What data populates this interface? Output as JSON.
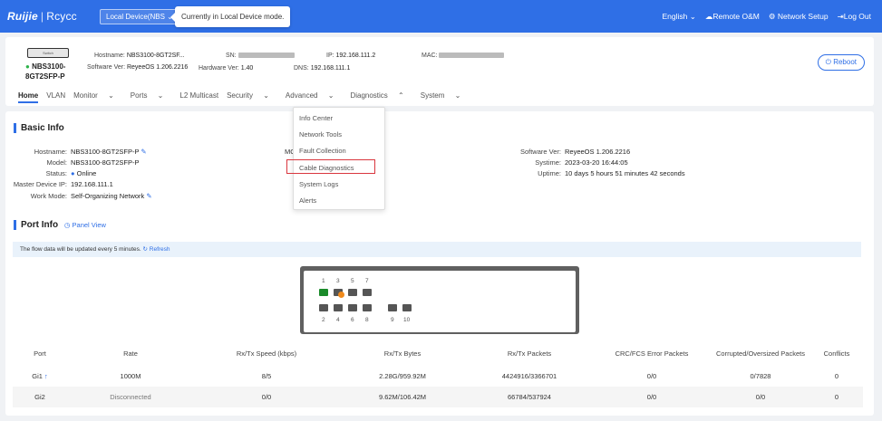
{
  "topbar": {
    "logo_brand": "Ruijie",
    "logo_sep": "|",
    "logo_sub": "Rcycc",
    "device_mode": "Local Device(NBS",
    "tip": "Currently in Local Device mode.",
    "language": "English",
    "remote": "Remote O&M",
    "network_setup": "Network Setup",
    "logout": "Log Out"
  },
  "device": {
    "icon_label": "Switch",
    "name_line1": "NBS3100-",
    "name_line2": "8GT2SFP-P",
    "hostname_label": "Hostname:",
    "hostname_value": "NBS3100-8GT2SF...",
    "sn_label": "SN:",
    "ip_label": "IP:",
    "ip_value": "192.168.111.2",
    "mac_label": "MAC:",
    "sw_label": "Software Ver:",
    "sw_value": "ReyeeOS 1.206.2216",
    "hw_label": "Hardware Ver:",
    "hw_value": "1.40",
    "dns_label": "DNS:",
    "dns_value": "192.168.111.1",
    "reboot": "Reboot"
  },
  "nav": [
    "Home",
    "VLAN",
    "Monitor",
    "Ports",
    "L2 Multicast",
    "Security",
    "Advanced",
    "Diagnostics",
    "System"
  ],
  "basic_info": {
    "title": "Basic Info",
    "hostname_label": "Hostname:",
    "hostname_value": "NBS3100-8GT2SFP-P",
    "model_label": "Model:",
    "model_value": "NBS3100-8GT2SFP-P",
    "status_label": "Status:",
    "status_value": "Online",
    "master_label": "Master Device IP:",
    "master_value": "192.168.111.1",
    "workmode_label": "Work Mode:",
    "workmode_value": "Self-Organizing Network",
    "mac_label": "MC",
    "sw_label": "Software Ver:",
    "sw_value": "ReyeeOS 1.206.2216",
    "systime_label": "Systime:",
    "systime_value": "2023-03-20 16:44:05",
    "uptime_label": "Uptime:",
    "uptime_value": "10 days 5 hours 51 minutes 42 seconds"
  },
  "port_info": {
    "title": "Port Info",
    "panel_view": "Panel View",
    "flow_note": "The flow data will be updated every 5 minutes.",
    "refresh": "Refresh",
    "top_numbers": [
      "1",
      "3",
      "5",
      "7"
    ],
    "bottom_numbers": [
      "2",
      "4",
      "6",
      "8",
      "9",
      "10"
    ]
  },
  "table": {
    "headers": [
      "Port",
      "Rate",
      "Rx/Tx Speed (kbps)",
      "Rx/Tx Bytes",
      "Rx/Tx Packets",
      "CRC/FCS Error Packets",
      "Corrupted/Oversized Packets",
      "Conflicts"
    ],
    "rows": [
      [
        "Gi1",
        "1000M",
        "8/5",
        "2.28G/959.92M",
        "4424916/3366701",
        "0/0",
        "0/7828",
        "0"
      ],
      [
        "Gi2",
        "Disconnected",
        "0/0",
        "9.62M/106.42M",
        "66784/537924",
        "0/0",
        "0/0",
        "0"
      ]
    ]
  },
  "diagnostics_menu": [
    "Info Center",
    "Network Tools",
    "Fault Collection",
    "Cable Diagnostics",
    "System Logs",
    "Alerts"
  ]
}
